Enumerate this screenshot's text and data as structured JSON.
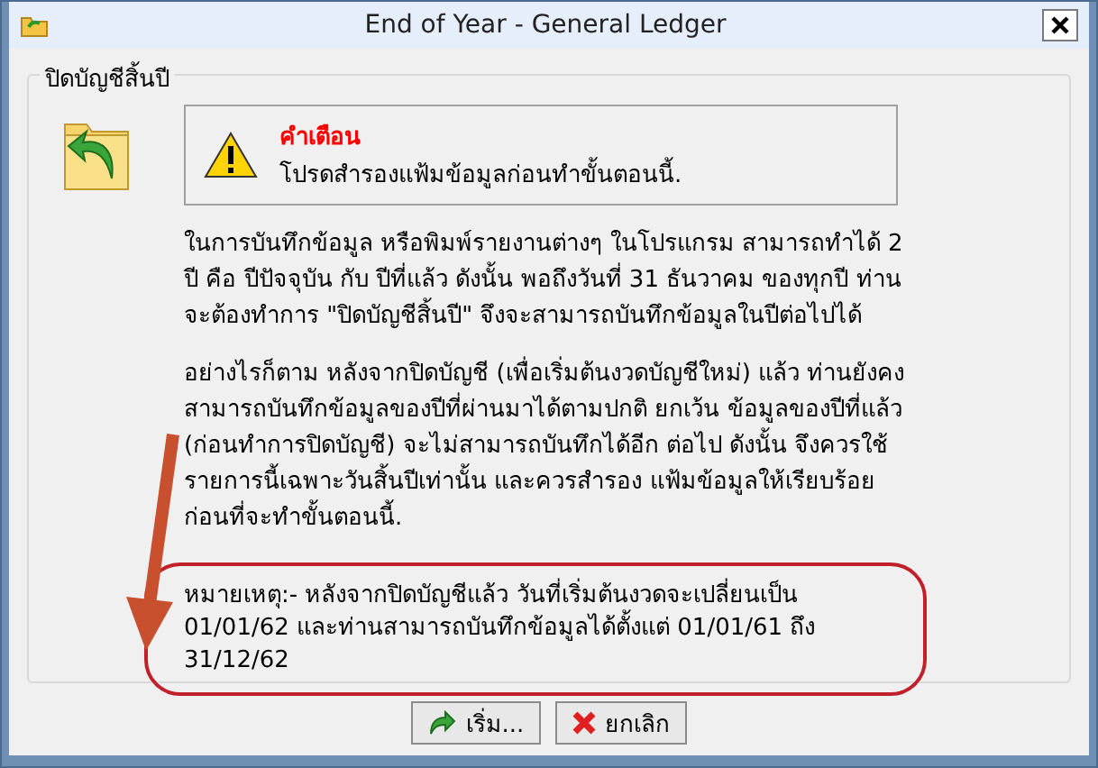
{
  "window": {
    "title": "End of Year - General Ledger"
  },
  "group": {
    "title": "ปิดบัญชีสิ้นปี"
  },
  "warning": {
    "title": "คำเตือน",
    "message": "โปรดสำรองแฟ้มข้อมูลก่อนทำขั้นตอนนี้."
  },
  "paragraphs": [
    "ในการบันทึกข้อมูล หรือพิมพ์รายงานต่างๆ ในโปรแกรม สามารถทำได้ 2 ปี คือ ปีปัจจุบัน กับ ปีที่แล้ว ดังนั้น พอถึงวันที่ 31 ธันวาคม ของทุกปี ท่านจะต้องทำการ \"ปิดบัญชีสิ้นปี\" จึงจะสามารถบันทึกข้อมูลในปีต่อไปได้",
    "อย่างไรก็ตาม หลังจากปิดบัญชี (เพื่อเริ่มต้นงวดบัญชีใหม่) แล้ว ท่านยังคงสามารถบันทึกข้อมูลของปีที่ผ่านมาได้ตามปกติ ยกเว้น ข้อมูลของปีที่แล้ว (ก่อนทำการปิดบัญชี) จะไม่สามารถบันทึกได้อีก ต่อไป ดังนั้น จึงควรใช้รายการนี้เฉพาะวันสิ้นปีเท่านั้น และควรสำรอง แฟ้มข้อมูลให้เรียบร้อยก่อนที่จะทำขั้นตอนนี้."
  ],
  "note": "หมายเหตุ:- หลังจากปิดบัญชีแล้ว วันที่เริ่มต้นงวดจะเปลี่ยนเป็น 01/01/62 และท่านสามารถบันทึกข้อมูลได้ตั้งแต่ 01/01/61 ถึง 31/12/62",
  "buttons": [
    {
      "kind": "start",
      "label": "เริ่ม..."
    },
    {
      "kind": "cancel",
      "label": "ยกเลิก"
    }
  ]
}
